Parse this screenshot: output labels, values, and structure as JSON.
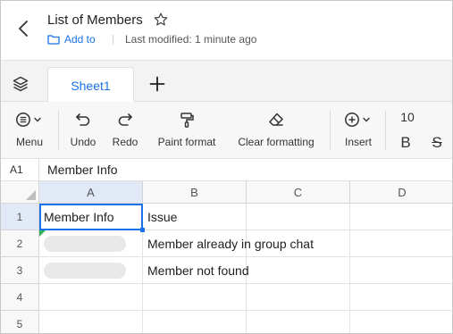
{
  "header": {
    "title": "List of Members",
    "add_to_label": "Add to",
    "last_modified": "Last modified: 1 minute ago"
  },
  "sheets": {
    "tabs": [
      {
        "label": "Sheet1",
        "active": true
      }
    ]
  },
  "toolbar": {
    "menu_label": "Menu",
    "undo_label": "Undo",
    "redo_label": "Redo",
    "paint_format_label": "Paint format",
    "clear_formatting_label": "Clear formatting",
    "insert_label": "Insert",
    "font_size": "10",
    "bold_label": "B",
    "strike_label": "S"
  },
  "formula_bar": {
    "cell_ref": "A1",
    "value": "Member Info"
  },
  "grid": {
    "columns": [
      "A",
      "B",
      "C",
      "D"
    ],
    "rows": [
      "1",
      "2",
      "3",
      "4",
      "5"
    ],
    "cells": {
      "A1": "Member Info",
      "B1": "Issue",
      "B2": "Member already in group chat",
      "B3": "Member not found"
    },
    "selected_cell": "A1"
  },
  "colors": {
    "accent": "#1a73e8",
    "comment_marker": "#35b05a",
    "selected_header": "#e1e9f7"
  }
}
